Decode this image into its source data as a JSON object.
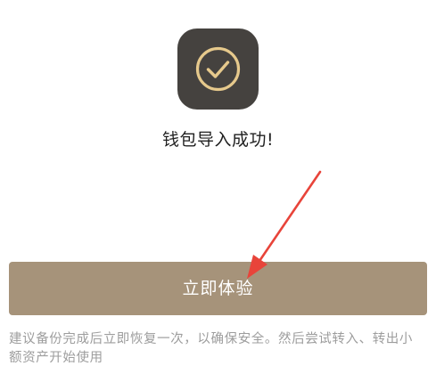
{
  "success": {
    "icon": "check-circle-icon",
    "title": "钱包导入成功!"
  },
  "primary_button": {
    "label": "立即体验"
  },
  "hint": {
    "text": "建议备份完成后立即恢复一次，以确保安全。然后尝试转入、转出小额资产开始使用"
  },
  "annotation": {
    "icon": "red-arrow-annotation"
  },
  "colors": {
    "icon_tile": "#45423f",
    "icon_stroke": "#e6c98c",
    "button_bg": "#a6937a",
    "button_text": "#ffffff",
    "hint_text": "#9d9d9d",
    "arrow": "#e8443a"
  }
}
